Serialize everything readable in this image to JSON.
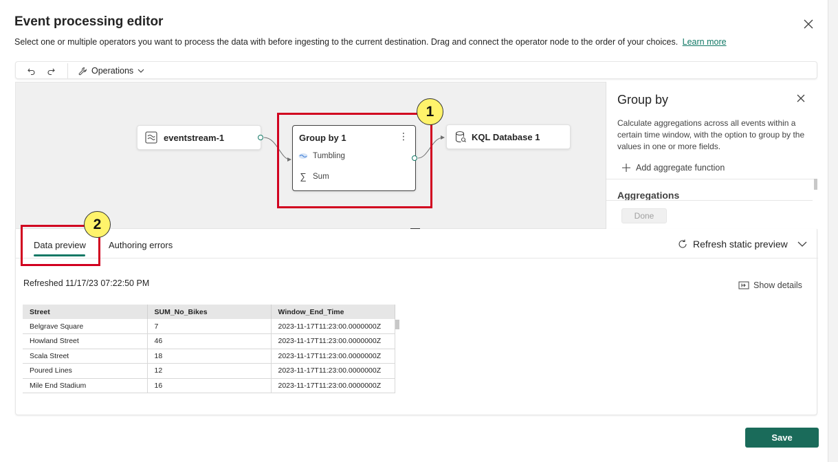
{
  "dialog": {
    "title": "Event processing editor",
    "subtitle": "Select one or multiple operators you want to process the data with before ingesting to the current destination. Drag and connect the operator node to the order of your choices.",
    "learn_more": "Learn more"
  },
  "toolbar": {
    "undo_icon": "undo-icon",
    "redo_icon": "redo-icon",
    "operations_label": "Operations"
  },
  "canvas": {
    "source_node": "eventstream-1",
    "operator_node": {
      "title": "Group by 1",
      "rows": [
        "Tumbling",
        "Sum"
      ]
    },
    "destination_node": "KQL Database 1",
    "callouts": [
      "1",
      "2"
    ]
  },
  "side_panel": {
    "title": "Group by",
    "description": "Calculate aggregations across all events within a certain time window, with the option to group by the values in one or more fields.",
    "add_label": "Add aggregate function",
    "section_label": "Aggregations",
    "done_label": "Done"
  },
  "bottom": {
    "tabs": [
      "Data preview",
      "Authoring errors"
    ],
    "active_tab": "Data preview",
    "refresh_label": "Refresh static preview",
    "refreshed_text": "Refreshed 11/17/23 07:22:50 PM",
    "show_details": "Show details",
    "table": {
      "columns": [
        "Street",
        "SUM_No_Bikes",
        "Window_End_Time"
      ],
      "rows": [
        [
          "Belgrave Square",
          "7",
          "2023-11-17T11:23:00.0000000Z"
        ],
        [
          "Howland Street",
          "46",
          "2023-11-17T11:23:00.0000000Z"
        ],
        [
          "Scala Street",
          "18",
          "2023-11-17T11:23:00.0000000Z"
        ],
        [
          "Poured Lines",
          "12",
          "2023-11-17T11:23:00.0000000Z"
        ],
        [
          "Mile End Stadium",
          "16",
          "2023-11-17T11:23:00.0000000Z"
        ]
      ]
    }
  },
  "footer": {
    "save_label": "Save"
  },
  "colors": {
    "accent": "#117865",
    "highlight": "#d1001f",
    "badge": "#fff36b",
    "save": "#1a6b5a"
  }
}
